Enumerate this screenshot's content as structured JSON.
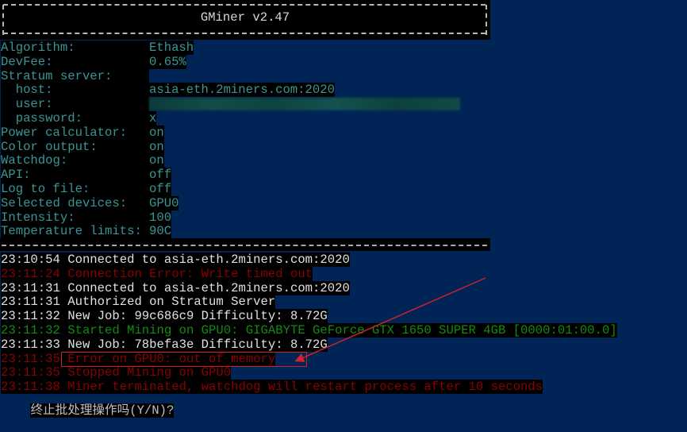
{
  "window": {
    "title": "GMiner v2.47"
  },
  "config": [
    {
      "label": "Algorithm:",
      "value": "Ethash"
    },
    {
      "label": "DevFee:",
      "value": "0.65%"
    },
    {
      "label": "Stratum server:",
      "value": ""
    },
    {
      "label": "  host:",
      "value": "asia-eth.2miners.com:2020"
    },
    {
      "label": "  user:",
      "value": "[redacted wallet address]"
    },
    {
      "label": "  password:",
      "value": "x"
    },
    {
      "label": "Power calculator:",
      "value": "on"
    },
    {
      "label": "Color output:",
      "value": "on"
    },
    {
      "label": "Watchdog:",
      "value": "on"
    },
    {
      "label": "API:",
      "value": "off"
    },
    {
      "label": "Log to file:",
      "value": "off"
    },
    {
      "label": "Selected devices:",
      "value": "GPU0"
    },
    {
      "label": "Intensity:",
      "value": "100"
    },
    {
      "label": "Temperature limits:",
      "value": "90C"
    }
  ],
  "log": [
    {
      "time": "23:10:54",
      "message": "Connected to asia-eth.2miners.com:2020",
      "level": "info"
    },
    {
      "time": "23:11:24",
      "message": "Connection Error: Write timed out",
      "level": "error"
    },
    {
      "time": "23:11:31",
      "message": "Connected to asia-eth.2miners.com:2020",
      "level": "info"
    },
    {
      "time": "23:11:31",
      "message": "Authorized on Stratum Server",
      "level": "info"
    },
    {
      "time": "23:11:32",
      "message": "New Job: 99c686c9 Difficulty: 8.72G",
      "level": "info"
    },
    {
      "time": "23:11:32",
      "message": "Started Mining on GPU0: GIGABYTE GeForce GTX 1650 SUPER 4GB [0000:01:00.0]",
      "level": "success"
    },
    {
      "time": "23:11:33",
      "message": "New Job: 78befa3e Difficulty: 8.72G",
      "level": "info"
    },
    {
      "time": "23:11:35",
      "message": "Error on GPU0: out of memory",
      "level": "error"
    },
    {
      "time": "23:11:35",
      "message": "Stopped Mining on GPU0",
      "level": "error"
    },
    {
      "time": "23:11:38",
      "message": "Miner terminated, watchdog will restart process after 10 seconds",
      "level": "error"
    }
  ],
  "prompt": {
    "text": "终止批处理操作吗(Y/N)?"
  },
  "colors": {
    "background": "#012456",
    "config_text": "#3a9696",
    "info_text": "#e0e0e0",
    "error_text": "#8b0000",
    "success_text": "#138a13",
    "annotation": "#d0202a"
  }
}
